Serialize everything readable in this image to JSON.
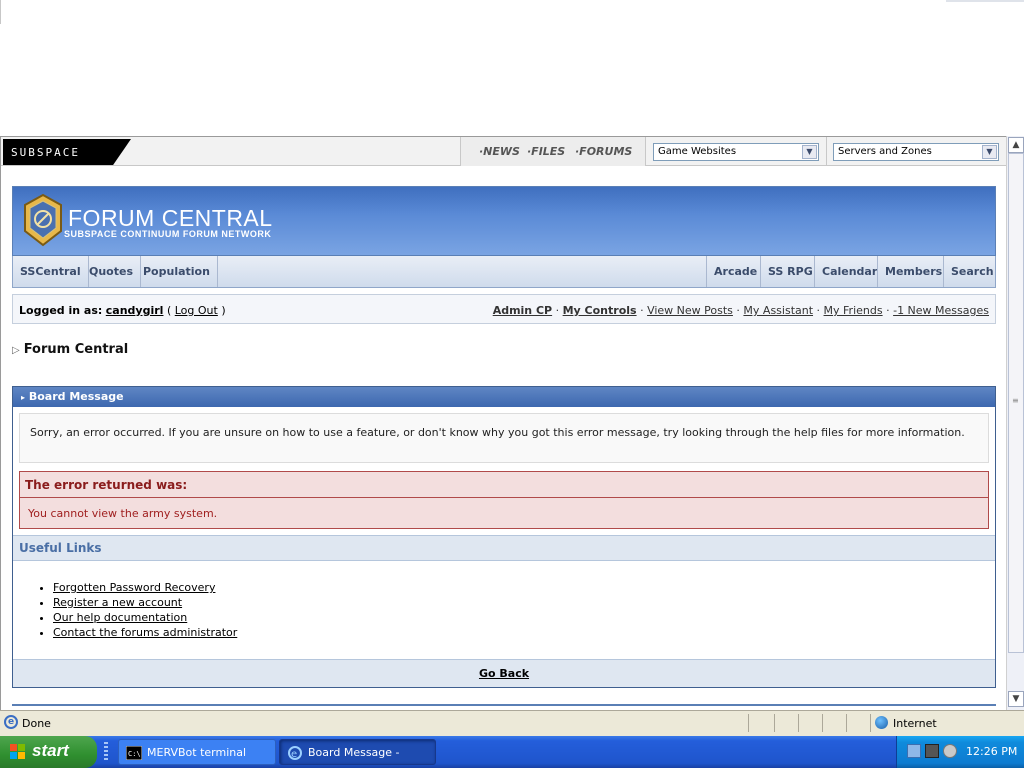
{
  "subspace": {
    "logo": "SUBSPACE",
    "links": [
      "·NEWS",
      "·FILES",
      "·FORUMS"
    ],
    "select_game": "Game Websites",
    "select_servers": "Servers and Zones"
  },
  "forum": {
    "title": "FORUM CENTRAL",
    "subtitle": "SUBSPACE CONTINUUM FORUM NETWORK",
    "nav_left": [
      "SSCentral",
      "Quotes",
      "Population"
    ],
    "nav_right": [
      "Arcade",
      "SS RPG",
      "Calendar",
      "Members",
      "Search"
    ]
  },
  "userbar": {
    "logged_in_label": "Logged in as:",
    "username": "candygirl",
    "logout": "Log Out",
    "links": [
      "Admin CP",
      "My Controls",
      "View New Posts",
      "My Assistant",
      "My Friends",
      "-1 New Messages"
    ]
  },
  "breadcrumb": "Forum Central",
  "board": {
    "header": "Board Message",
    "message": "Sorry, an error occurred. If you are unsure on how to use a feature, or don't know why you got this error message, try looking through the help files for more information.",
    "error_title": "The error returned was:",
    "error_message": "You cannot view the army system.",
    "useful_links_title": "Useful Links",
    "useful_links": [
      "Forgotten Password Recovery",
      "Register a new account",
      "Our help documentation",
      "Contact the forums administrator"
    ],
    "go_back": "Go Back"
  },
  "status": {
    "text": "Done",
    "zone": "Internet"
  },
  "taskbar": {
    "start": "start",
    "tasks": [
      "MERVBot terminal",
      "Board Message - Micr..."
    ],
    "time": "12:26 PM"
  }
}
